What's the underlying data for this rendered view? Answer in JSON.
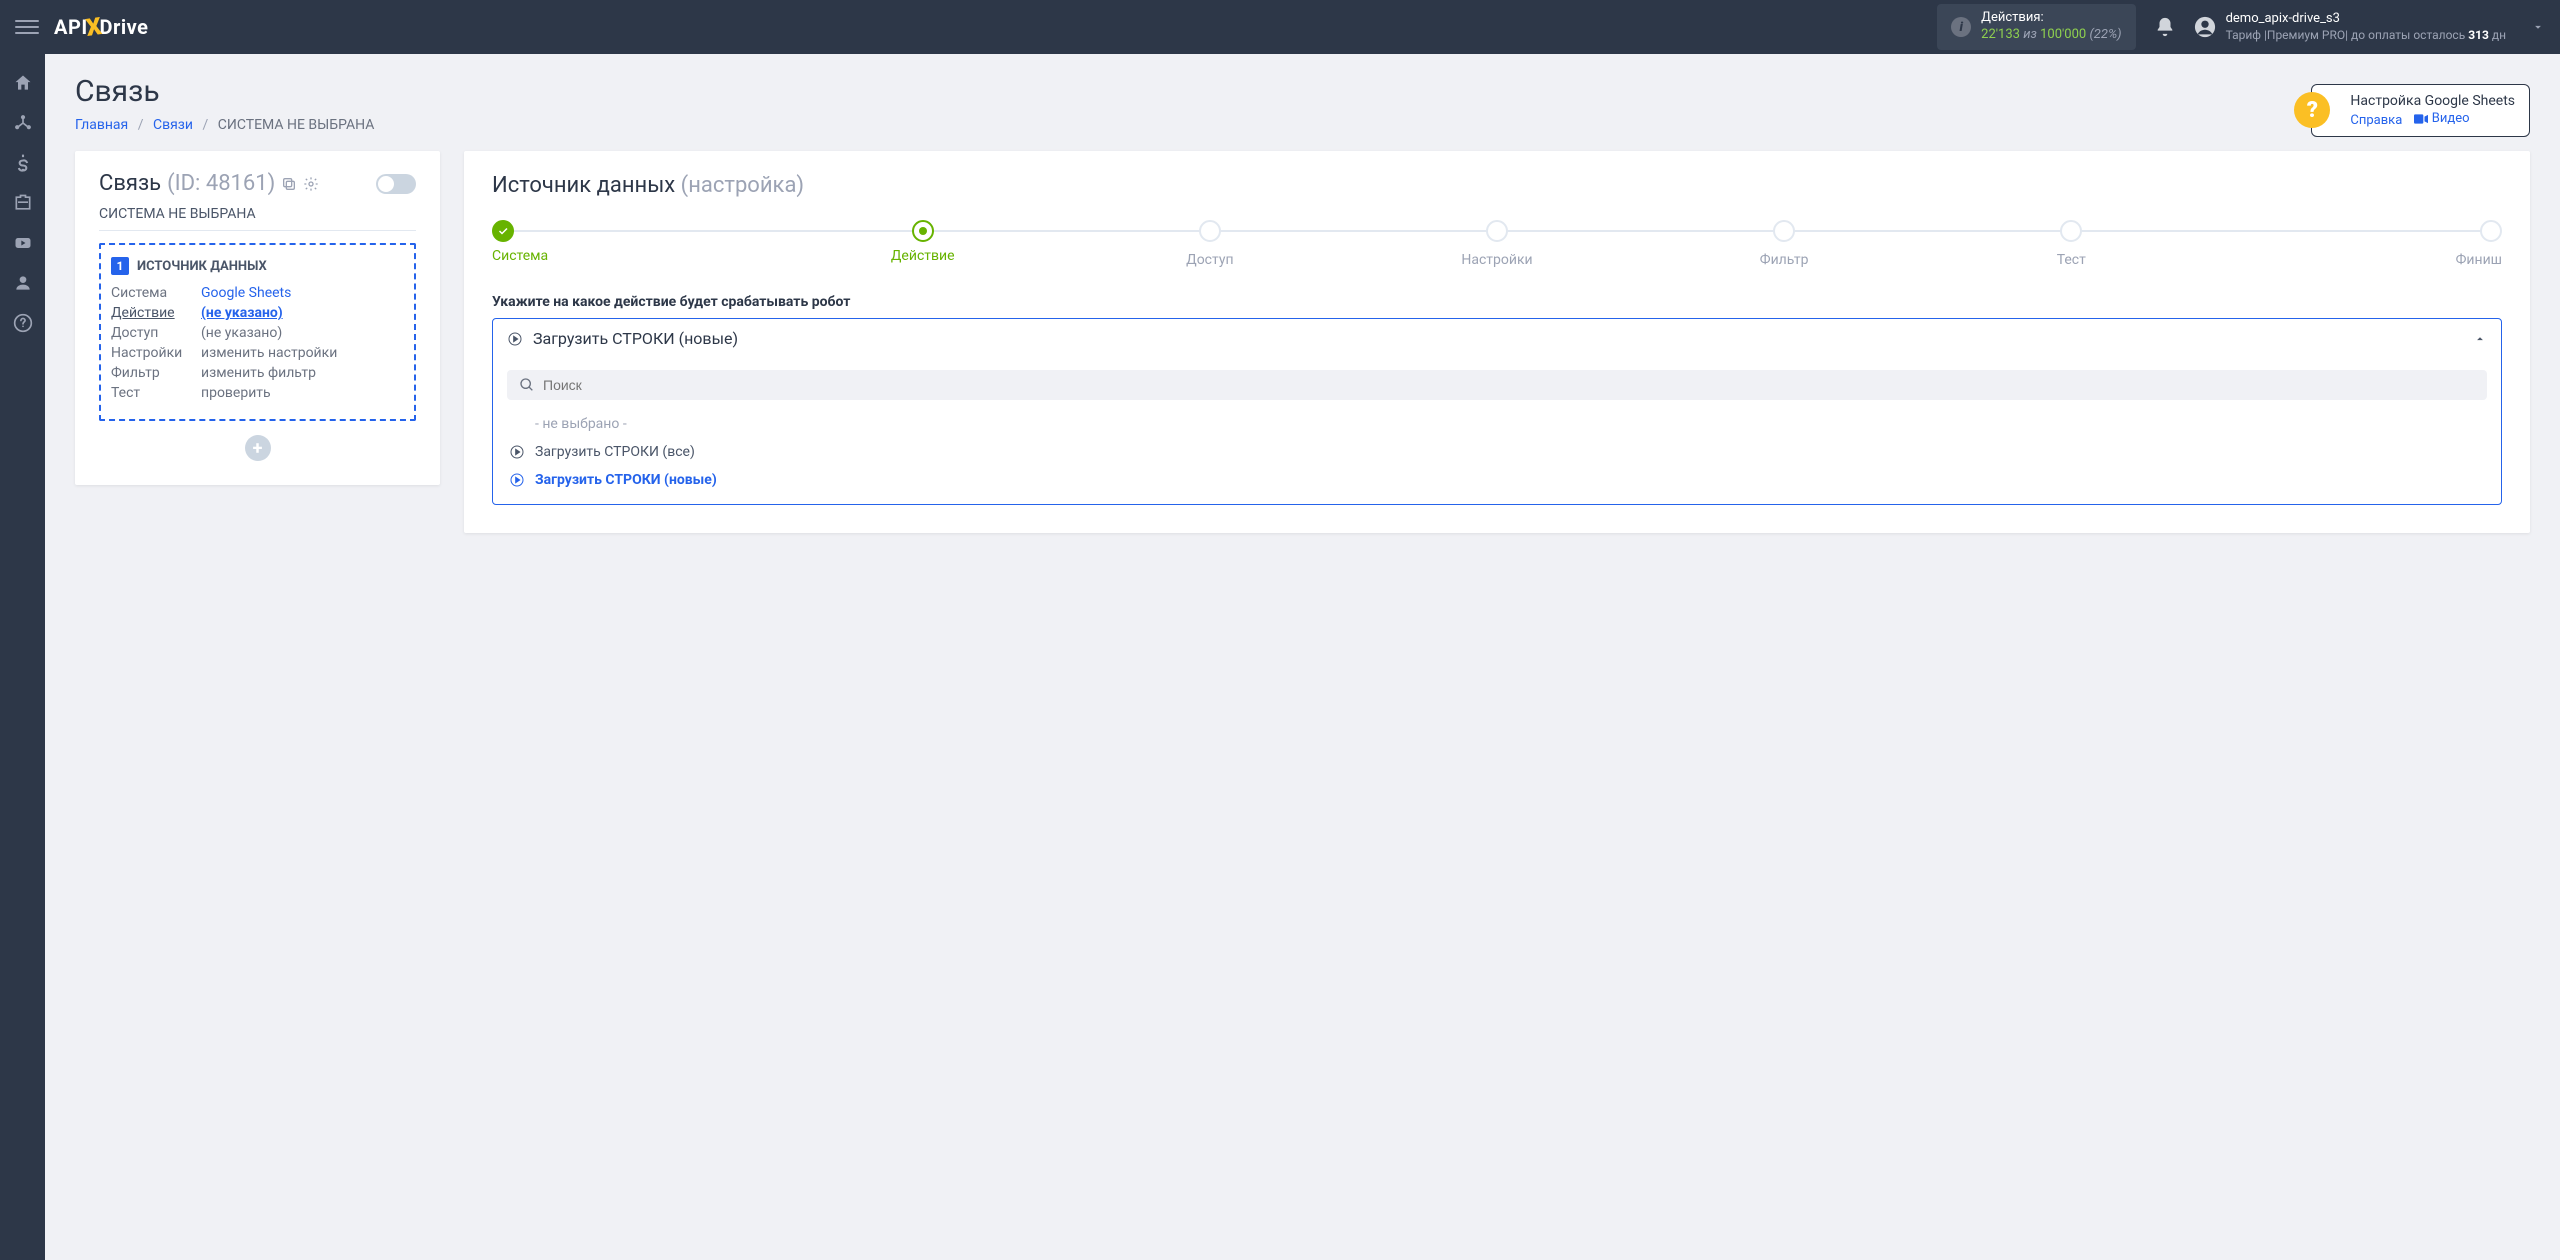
{
  "topbar": {
    "logo_pre": "API",
    "logo_post": "Drive",
    "actions_label": "Действия:",
    "actions_used": "22'133",
    "actions_of": "из",
    "actions_total": "100'000",
    "actions_pct": "(22%)",
    "username": "demo_apix-drive_s3",
    "tariff_prefix": "Тариф |Премиум PRO| до оплаты осталось ",
    "tariff_days": "313",
    "tariff_suffix": " дн"
  },
  "page": {
    "title": "Связь",
    "bc_home": "Главная",
    "bc_links": "Связи",
    "bc_current": "СИСТЕМА НЕ ВЫБРАНА"
  },
  "help": {
    "title": "Настройка Google Sheets",
    "link_ref": "Справка",
    "link_video": "Видео"
  },
  "left": {
    "title": "Связь",
    "id": "(ID: 48161)",
    "subtitle": "СИСТЕМА НЕ ВЫБРАНА",
    "box_title": "ИСТОЧНИК ДАННЫХ",
    "rows": {
      "system_label": "Система",
      "system_value": "Google Sheets",
      "action_label": "Действие",
      "action_value": "(не указано)",
      "access_label": "Доступ",
      "access_value": "(не указано)",
      "settings_label": "Настройки",
      "settings_value": "изменить настройки",
      "filter_label": "Фильтр",
      "filter_value": "изменить фильтр",
      "test_label": "Тест",
      "test_value": "проверить"
    }
  },
  "right": {
    "title": "Источник данных",
    "title_sub": "(настройка)",
    "steps": [
      "Система",
      "Действие",
      "Доступ",
      "Настройки",
      "Фильтр",
      "Тест",
      "Финиш"
    ],
    "field_label": "Укажите на какое действие будет срабатывать робот",
    "selected": "Загрузить СТРОКИ (новые)",
    "search_placeholder": "Поиск",
    "options": {
      "none": "- не выбрано -",
      "all": "Загрузить СТРОКИ (все)",
      "new": "Загрузить СТРОКИ (новые)"
    }
  }
}
